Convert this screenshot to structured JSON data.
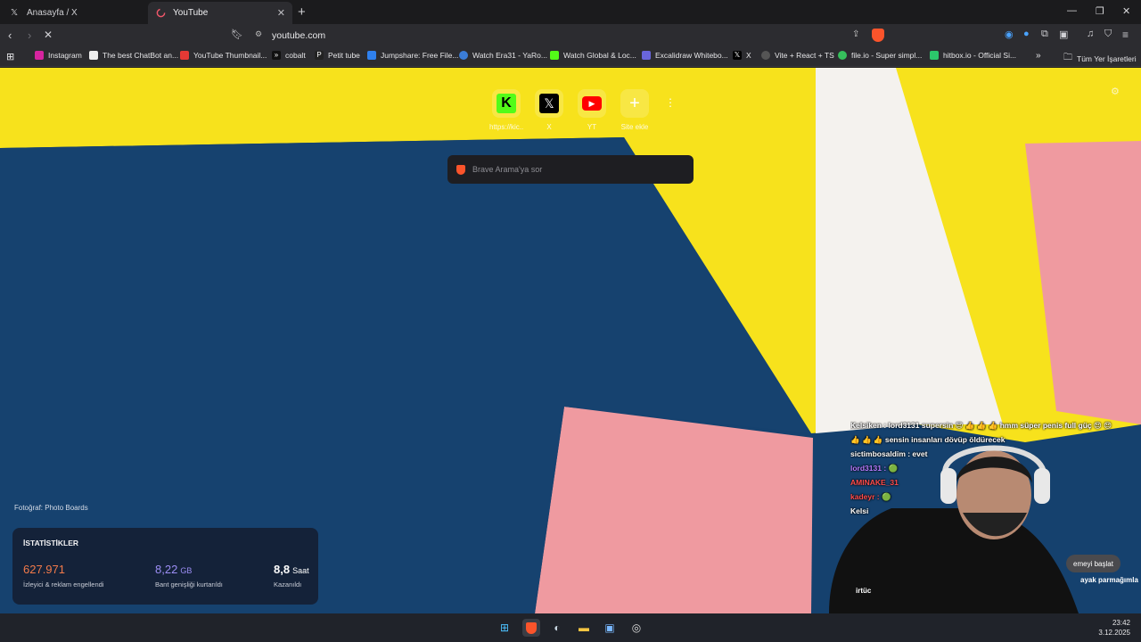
{
  "tabs": [
    {
      "title": "Anasayfa / X",
      "icon": "x-logo-icon",
      "active": false
    },
    {
      "title": "YouTube",
      "icon": "loading-spinner-icon",
      "active": true
    }
  ],
  "address_bar": {
    "url": "youtube.com"
  },
  "bookmarks": [
    {
      "label": "Instagram",
      "icon": "instagram-icon"
    },
    {
      "label": "The best ChatBot an...",
      "icon": "chatbot-icon"
    },
    {
      "label": "YouTube Thumbnail...",
      "icon": "thumbnail-icon"
    },
    {
      "label": "cobalt",
      "icon": "cobalt-icon"
    },
    {
      "label": "Petit tube",
      "icon": "petit-tube-icon"
    },
    {
      "label": "Jumpshare: Free File...",
      "icon": "jumpshare-icon"
    },
    {
      "label": "Watch Era31 - YaRo...",
      "icon": "twitch-icon"
    },
    {
      "label": "Watch Global & Loc...",
      "icon": "kick-icon"
    },
    {
      "label": "Excalidraw Whitebo...",
      "icon": "excalidraw-icon"
    },
    {
      "label": "X",
      "icon": "x-logo-icon"
    },
    {
      "label": "Vite + React + TS",
      "icon": "globe-icon"
    },
    {
      "label": "file.io - Super simpl...",
      "icon": "fileio-icon"
    },
    {
      "label": "hitbox.io - Official Si...",
      "icon": "hitbox-icon"
    }
  ],
  "bookmarks_folder": "Tüm Yer İşaretleri",
  "shortcuts": [
    {
      "label": "https://kic...",
      "icon": "kick-logo-icon"
    },
    {
      "label": "X",
      "icon": "x-logo-icon"
    },
    {
      "label": "YT",
      "icon": "youtube-logo-icon"
    },
    {
      "label": "Site ekle",
      "icon": "plus-icon"
    }
  ],
  "search": {
    "placeholder": "Brave Arama'ya sor"
  },
  "photo_credit": "Fotoğraf: Photo Boards",
  "stats": {
    "heading": "İSTATİSTİKLER",
    "items": [
      {
        "value": "627.971",
        "unit": "",
        "label": "İzleyici & reklam engellendi",
        "color": "#f27a4a"
      },
      {
        "value": "8,22",
        "unit": "GB",
        "label": "Bant genişliği kurtarıldı",
        "color": "#9c8ef5"
      },
      {
        "value": "8,8",
        "unit": "Saat",
        "label": "Kazanıldı",
        "color": "#ffffff"
      }
    ]
  },
  "stream_overlay": {
    "chat": [
      "Kelsiken : lord3131 supersin 😍 👍 👍 👍 hmm süper penis full güç 😍 😍",
      "👍 👍 👍 sensin insanları dövüp öldürecek",
      "sictimbosaldim : evet",
      "lord3131 : 🟢",
      "AMINAKE_31",
      "kadeyr : 🟢",
      "Kelsi"
    ],
    "button_label": "emeyi başlat",
    "partial_text": "ayak parmağımla",
    "partial_text_2": "irtüc"
  },
  "taskbar": {
    "clock_time": "23:42",
    "clock_date": "3.12.2025"
  },
  "colors": {
    "background_yellow": "#f7e21c",
    "background_blue": "#15416e",
    "background_pink": "#ef9aa0",
    "background_white": "#f4f2ee",
    "brave_orange": "#fb542b"
  }
}
